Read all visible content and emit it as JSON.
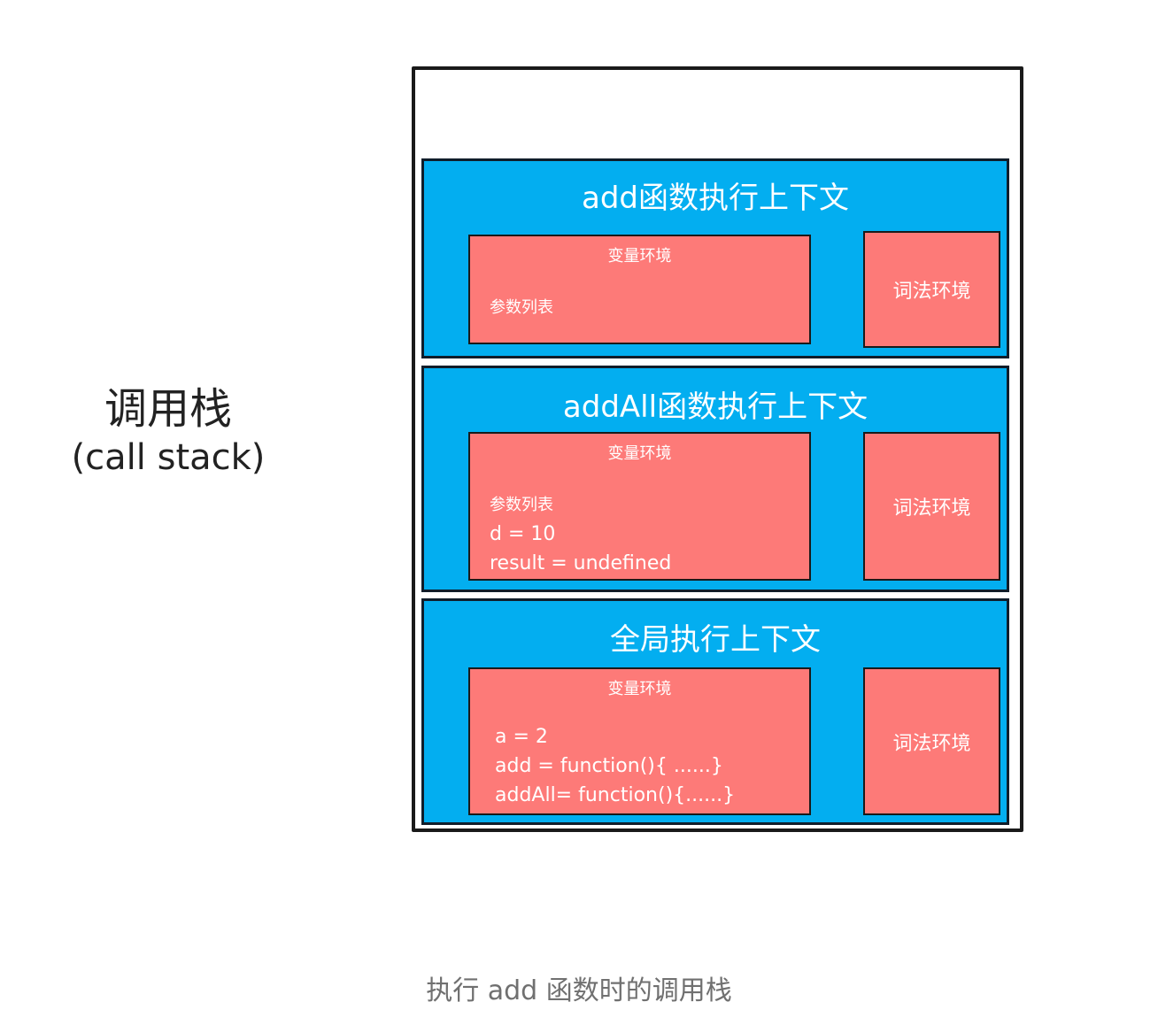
{
  "side_label": {
    "title": "调用栈",
    "subtitle": "(call stack)"
  },
  "frames": [
    {
      "title": "add函数执行上下文",
      "variable_env": {
        "title": "变量环境",
        "lines": [
          "参数列表"
        ]
      },
      "lexical_env": "词法环境"
    },
    {
      "title": "addAll函数执行上下文",
      "variable_env": {
        "title": "变量环境",
        "lines": [
          "参数列表",
          "d = 10",
          "result = undefined"
        ]
      },
      "lexical_env": "词法环境"
    },
    {
      "title": "全局执行上下文",
      "variable_env": {
        "title": "变量环境",
        "lines": [
          "a = 2",
          "add = function(){ ......}",
          "addAll= function(){......}"
        ]
      },
      "lexical_env": "词法环境"
    }
  ],
  "caption": "执行 add 函数时的调用栈",
  "colors": {
    "frame": "#03aef0",
    "env": "#fd7a78",
    "outline": "#1a1a1a"
  }
}
